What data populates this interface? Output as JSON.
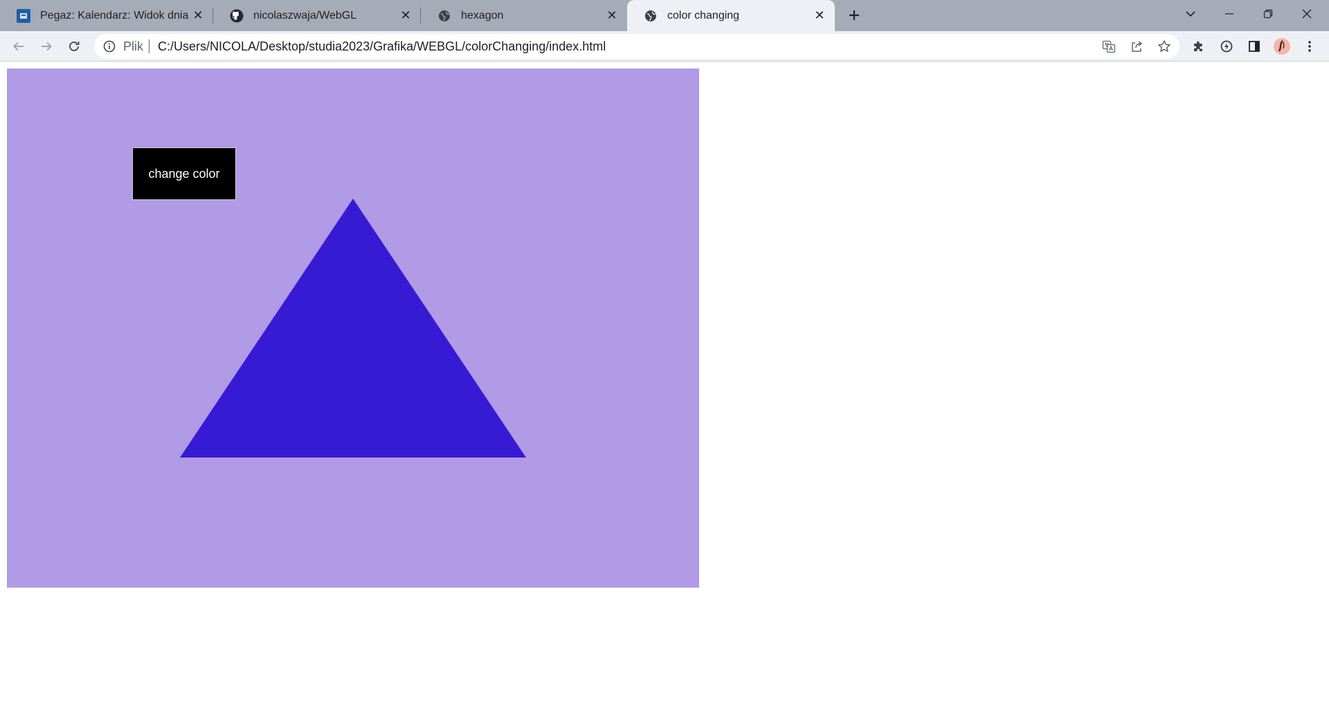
{
  "browser": {
    "tabs": [
      {
        "title": "Pegaz: Kalendarz: Widok dnia: śro",
        "favicon": "pegaz-logo-icon",
        "active": false
      },
      {
        "title": "nicolaszwaja/WebGL",
        "favicon": "github-icon",
        "active": false
      },
      {
        "title": "hexagon",
        "favicon": "globe-icon",
        "active": false
      },
      {
        "title": "color changing",
        "favicon": "globe-icon",
        "active": true
      }
    ],
    "address": {
      "scheme_label": "Plik",
      "url": "C:/Users/NICOLA/Desktop/studia2023/Grafika/WEBGL/colorChanging/index.html"
    }
  },
  "page": {
    "button_label": "change color",
    "colors": {
      "canvas_background": "#b19ae6",
      "triangle": "#371bd4",
      "button_background": "#000000",
      "button_text": "#ffffff"
    }
  }
}
